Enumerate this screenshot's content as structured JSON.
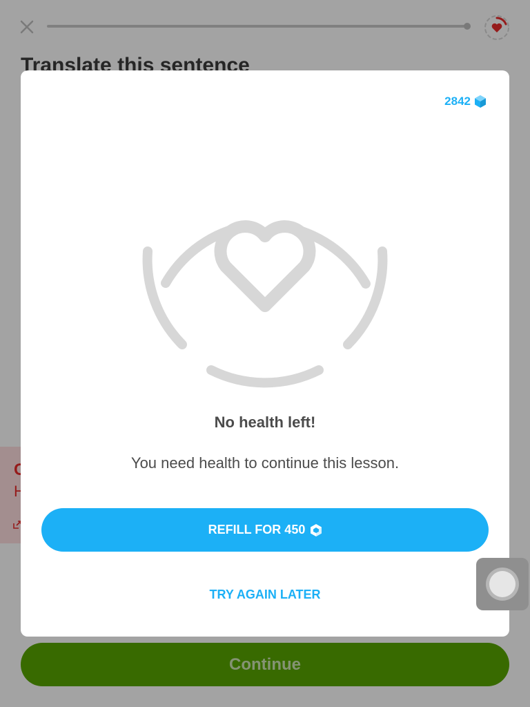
{
  "lesson": {
    "title": "Translate this sentence",
    "continue_label": "Continue",
    "feedback": {
      "title": "C",
      "text": "H"
    }
  },
  "modal": {
    "gems": "2842",
    "title": "No health left!",
    "message": "You need health to continue this lesson.",
    "refill_label": "REFILL FOR 450",
    "later_label": "TRY AGAIN LATER"
  },
  "icons": {
    "close": "close-icon",
    "health": "heart-icon",
    "gem": "gem-icon",
    "illustration": "broken-heart-ring-icon"
  },
  "colors": {
    "accent_blue": "#1cb0f6",
    "continue_green": "#58a700",
    "heart_red": "#ea2b2b",
    "illustration_gray": "#d7d7d7"
  }
}
